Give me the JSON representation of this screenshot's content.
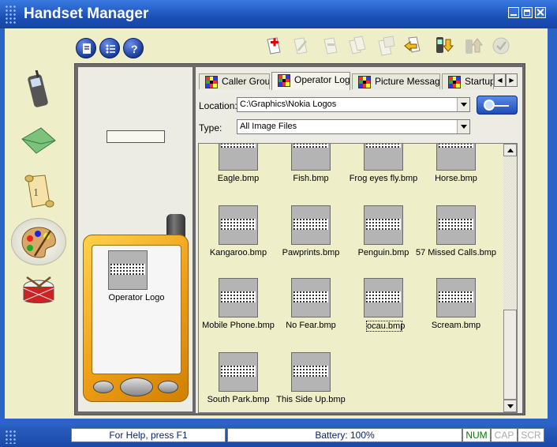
{
  "app": {
    "title": "Handset Manager"
  },
  "window_controls": [
    "minimize",
    "maximize",
    "close"
  ],
  "top_icons": [
    {
      "icon": "document-icon"
    },
    {
      "icon": "list-icon"
    },
    {
      "icon": "help-icon"
    }
  ],
  "toolbar": [
    {
      "icon": "new-icon",
      "enabled": true
    },
    {
      "icon": "edit-icon",
      "enabled": false
    },
    {
      "icon": "cut-icon",
      "enabled": false
    },
    {
      "icon": "copy-icon",
      "enabled": false
    },
    {
      "icon": "paste-icon",
      "enabled": false
    },
    {
      "icon": "undo-icon",
      "enabled": true
    },
    {
      "icon": "download-icon",
      "enabled": true
    },
    {
      "icon": "upload-icon",
      "enabled": false
    },
    {
      "icon": "check-icon",
      "enabled": false
    }
  ],
  "nav": [
    {
      "icon": "phone-icon",
      "selected": false
    },
    {
      "icon": "envelope-icon",
      "selected": false
    },
    {
      "icon": "scroll-icon",
      "selected": false
    },
    {
      "icon": "palette-icon",
      "selected": true
    },
    {
      "icon": "drum-icon",
      "selected": false
    }
  ],
  "preview": {
    "label": "Operator Logo"
  },
  "tabs": [
    {
      "label": "Caller Group",
      "active": false
    },
    {
      "label": "Operator Logo",
      "active": true
    },
    {
      "label": "Picture Message",
      "active": false
    },
    {
      "label": "Startup L",
      "active": false
    }
  ],
  "location": {
    "label": "Location:",
    "value": "C:\\Graphics\\Nokia Logos"
  },
  "type": {
    "label": "Type:",
    "value": "All Image Files"
  },
  "files": [
    {
      "name": "Eagle.bmp",
      "selected": false
    },
    {
      "name": "Fish.bmp",
      "selected": false
    },
    {
      "name": "Frog eyes fly.bmp",
      "selected": false
    },
    {
      "name": "Horse.bmp",
      "selected": false
    },
    {
      "name": "Kangaroo.bmp",
      "selected": false
    },
    {
      "name": "Pawprints.bmp",
      "selected": false
    },
    {
      "name": "Penguin.bmp",
      "selected": false
    },
    {
      "name": "57 Missed Calls.bmp",
      "selected": false
    },
    {
      "name": "Mobile Phone.bmp",
      "selected": false
    },
    {
      "name": "No Fear.bmp",
      "selected": false
    },
    {
      "name": "ocau.bmp",
      "selected": true
    },
    {
      "name": "Scream.bmp",
      "selected": false
    },
    {
      "name": "South Park.bmp",
      "selected": false
    },
    {
      "name": "This Side Up.bmp",
      "selected": false
    }
  ],
  "status": {
    "help": "For Help, press F1",
    "battery": "Battery: 100%",
    "num": "NUM",
    "cap": "CAP",
    "scr": "SCR"
  }
}
